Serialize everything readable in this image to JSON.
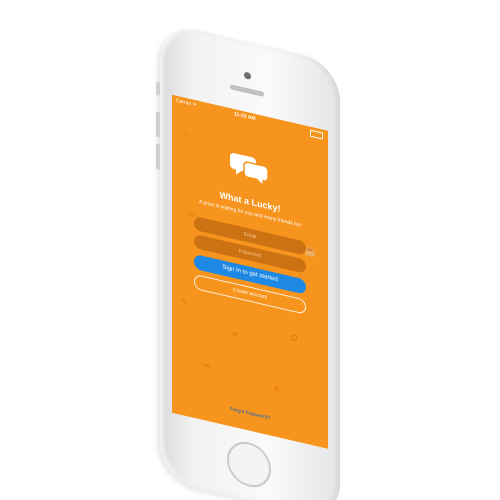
{
  "status_bar": {
    "carrier": "Carrier ✈",
    "time": "11:23 AM"
  },
  "app": {
    "title": "What a Lucky!",
    "subtitle": "A prize is waiting for you and many friends too",
    "email_placeholder": "Email",
    "password_placeholder": "Password",
    "sign_in_label": "Sign In to get started",
    "create_account_label": "Create account",
    "forgot_password_label": "Forgot Password?"
  },
  "colors": {
    "background": "#f7941d",
    "primary_button": "#1e88e5",
    "forgot_link": "#1565c0"
  },
  "icons": [
    "chat-bubbles-logo-icon",
    "battery-icon",
    "home-button-icon"
  ]
}
